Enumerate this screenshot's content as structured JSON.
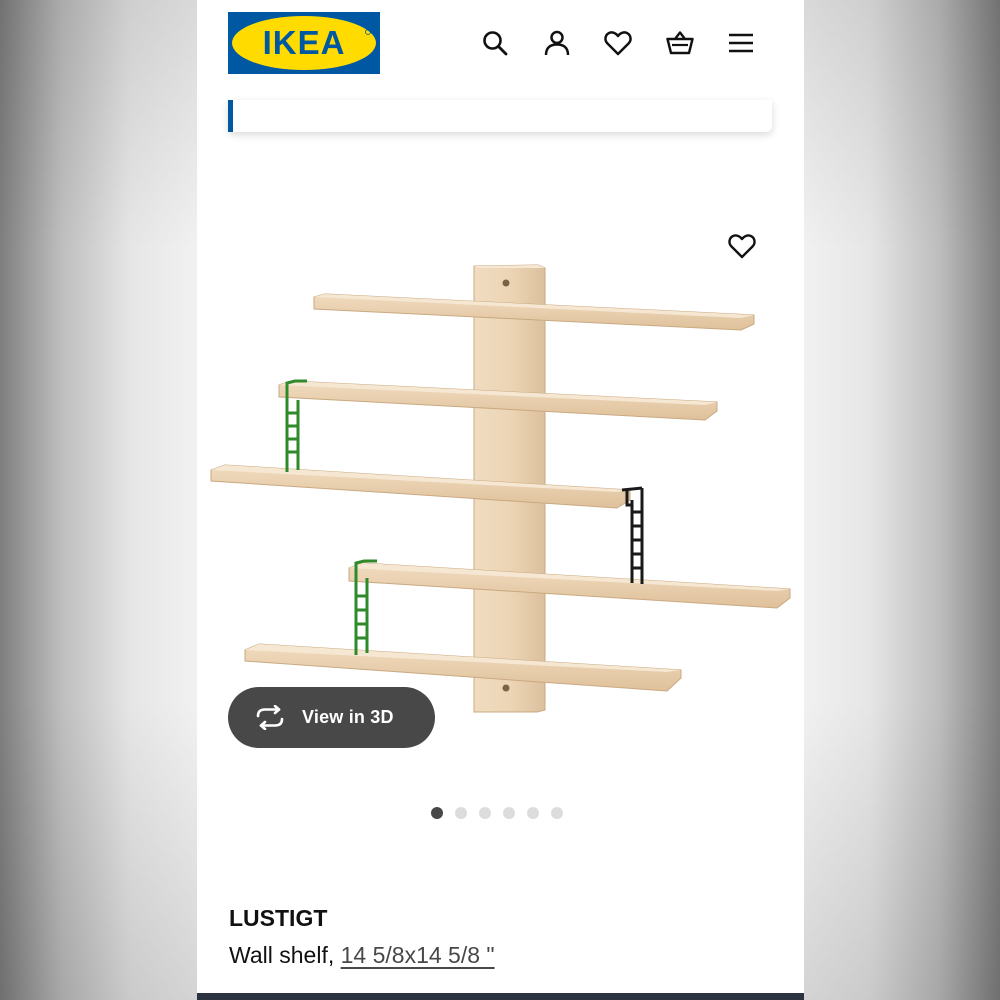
{
  "header": {
    "logo_text": "IKEA",
    "icons": [
      "search-icon",
      "user-icon",
      "heart-icon",
      "basket-icon",
      "menu-icon"
    ]
  },
  "brand_colors": {
    "ikea_blue": "#0058A3",
    "ikea_yellow": "#FFDB00",
    "button_dark": "#484848"
  },
  "gallery": {
    "view_3d_label": "View in 3D",
    "dot_count": 6,
    "active_dot": 0
  },
  "product": {
    "name": "LUSTIGT",
    "type": "Wall shelf, ",
    "size": "14 5/8x14 5/8 \""
  }
}
